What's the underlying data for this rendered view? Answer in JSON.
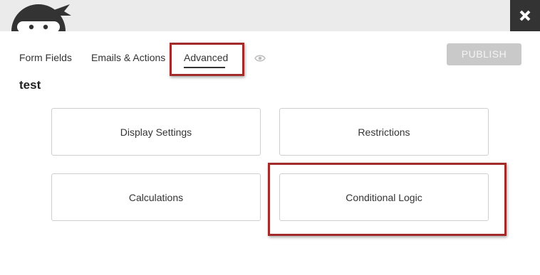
{
  "header": {
    "logo_icon": "ninja-logo-icon",
    "close_icon": "close-x-icon"
  },
  "tabs": [
    {
      "label": "Form Fields",
      "active": false
    },
    {
      "label": "Emails & Actions",
      "active": false
    },
    {
      "label": "Advanced",
      "active": true
    }
  ],
  "preview_icon": "eye-icon",
  "publish_label": "PUBLISH",
  "form_title": "test",
  "cards": [
    {
      "label": "Display Settings"
    },
    {
      "label": "Restrictions"
    },
    {
      "label": "Calculations"
    },
    {
      "label": "Conditional Logic"
    }
  ],
  "colors": {
    "highlight": "#a12b2b",
    "header_bg": "#ebebeb",
    "close_bg": "#333333",
    "publish_bg": "#c9c9c9"
  }
}
